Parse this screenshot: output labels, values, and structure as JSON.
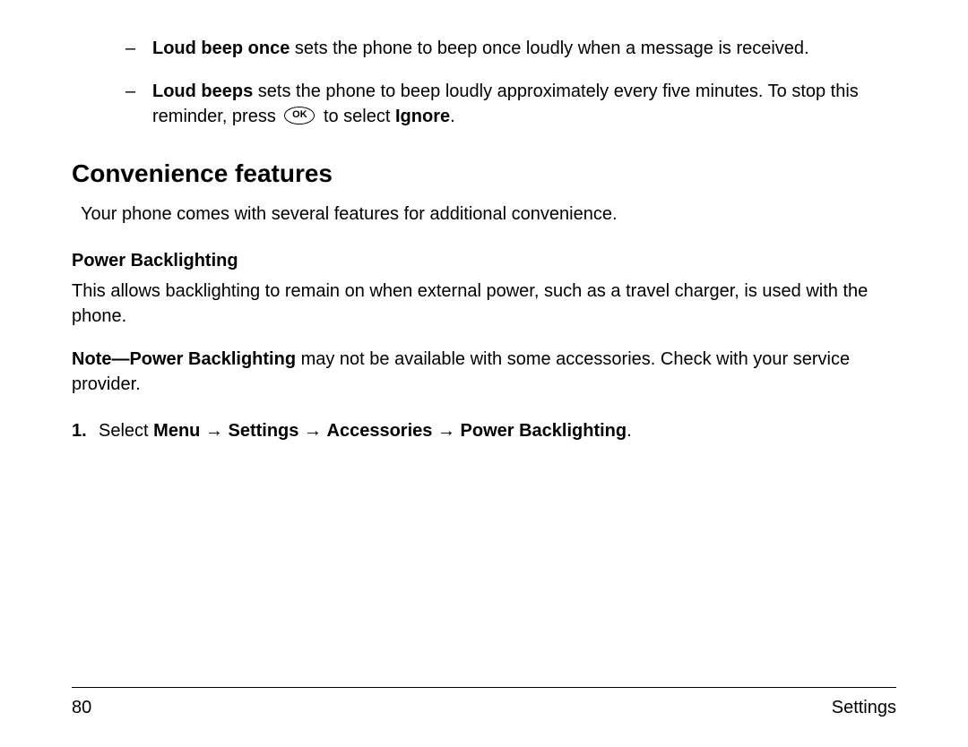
{
  "bullets": {
    "b1_bold": "Loud beep once",
    "b1_rest": " sets the phone to beep once loudly when a message is received.",
    "b2_bold": "Loud beeps",
    "b2_part1": " sets the phone to beep loudly approximately every five minutes. To stop this reminder, press ",
    "b2_part2": " to select ",
    "b2_ignore": "Ignore",
    "b2_part3": ".",
    "ok_label": "OK"
  },
  "heading": "Convenience features",
  "intro": "Your phone comes with several features for additional convenience.",
  "subheading": "Power Backlighting",
  "body1": "This allows backlighting to remain on when external power, such as a travel charger, is used with the phone.",
  "note_bold": "Note—Power Backlighting",
  "note_rest": " may not be available with some accessories. Check with your service provider.",
  "step": {
    "num": "1.",
    "prefix": "Select ",
    "menu": "Menu",
    "arrow": " → ",
    "settings": "Settings",
    "accessories": "Accessories",
    "pb": "Power Backlighting",
    "dot": "."
  },
  "footer": {
    "page": "80",
    "section": "Settings"
  }
}
